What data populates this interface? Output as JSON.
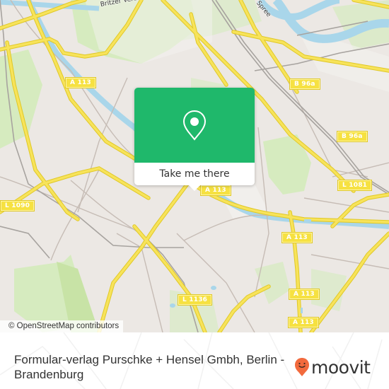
{
  "map": {
    "road_labels": [
      {
        "id": "a113-nw",
        "text": "A 113"
      },
      {
        "id": "b96a-n",
        "text": "B 96a"
      },
      {
        "id": "b96a-e",
        "text": "B 96a"
      },
      {
        "id": "l1081",
        "text": "L 1081"
      },
      {
        "id": "l1090",
        "text": "L 1090"
      },
      {
        "id": "a113-center",
        "text": "A 113"
      },
      {
        "id": "a113-east",
        "text": "A 113"
      },
      {
        "id": "a113-se",
        "text": "A 113"
      },
      {
        "id": "l1136",
        "text": "L 1136"
      },
      {
        "id": "a113-south",
        "text": "A 113"
      }
    ],
    "street_names": [
      {
        "id": "britzer-verbindung",
        "text": "Britzer Verbindung"
      },
      {
        "id": "spree",
        "text": "Spree"
      }
    ],
    "colors": {
      "land": "#ece8e4",
      "park": "#cfe8b4",
      "water": "#a9d6ea",
      "road_major": "#f5df4d",
      "rail": "#9a9a9a"
    }
  },
  "popup": {
    "icon": "map-pin-icon",
    "action_label": "Take me there",
    "accent_color": "#1fb86b"
  },
  "attribution": "© OpenStreetMap contributors",
  "footer": {
    "place_name": "Formular-verlag Purschke + Hensel Gmbh, Berlin - Brandenburg",
    "logo_text": "moovit",
    "logo_icon": "moovit-pin-smile-icon",
    "logo_color": "#f26a3d"
  }
}
